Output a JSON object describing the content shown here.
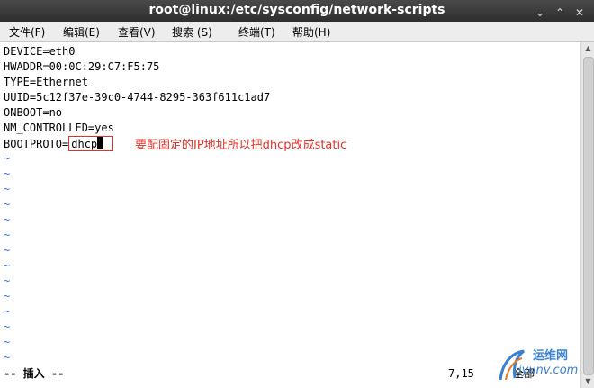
{
  "window": {
    "title": "root@linux:/etc/sysconfig/network-scripts",
    "buttons": [
      "⌄",
      "⌃",
      "✕"
    ]
  },
  "menu": [
    "文件(F)",
    "编辑(E)",
    "查看(V)",
    "搜索 (S)",
    "终端(T)",
    "帮助(H)"
  ],
  "file_lines": [
    "DEVICE=eth0",
    "HWADDR=00:0C:29:C7:F5:75",
    "TYPE=Ethernet",
    "UUID=5c12f37e-39c0-4744-8295-363f611c1ad7",
    "ONBOOT=no",
    "NM_CONTROLLED=yes"
  ],
  "edit_line": {
    "key": "BOOTPROTO=",
    "value": "dhcp"
  },
  "annotation": "要配固定的IP地址所以把dhcp改成static",
  "tilde_char": "~",
  "status": {
    "mode": "-- 插入 --",
    "position": "7,15",
    "percent": "全部"
  },
  "watermark": {
    "name": "运维网",
    "url": "iyunv.com"
  },
  "colors": {
    "annotation": "#e0302a",
    "tilde": "#3b6fd9",
    "watermark": "#3a7fd0"
  }
}
